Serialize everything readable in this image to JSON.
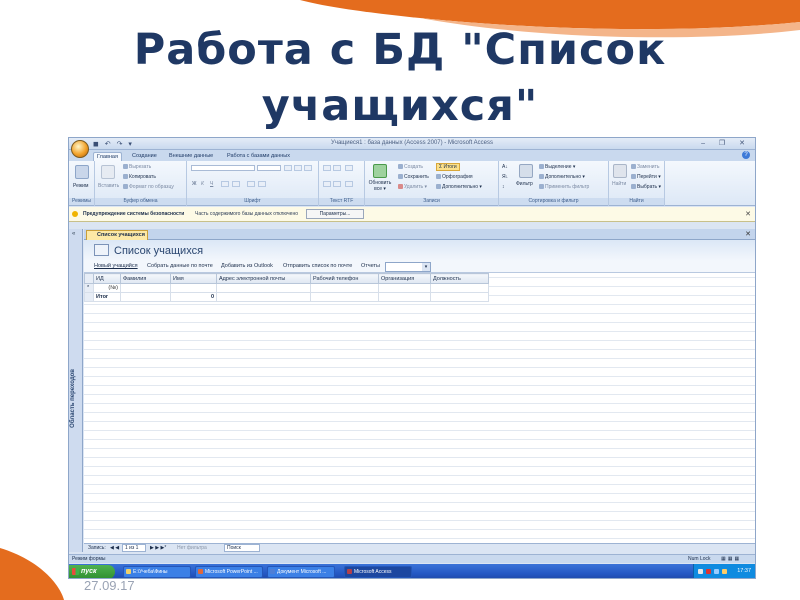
{
  "slide": {
    "title": "Работа с БД \"Список учащихся\"",
    "date": "27.09.17"
  },
  "window": {
    "title": "Учащиеся1 : база данных (Access 2007) - Microsoft Access",
    "qat": "◼ ↶ ↷ ▾",
    "controls": "– ❐ ✕",
    "help": "?"
  },
  "ribbon": {
    "tabs": [
      "Главная",
      "Создание",
      "Внешние данные",
      "Работа с базами данных"
    ],
    "groups": {
      "views": {
        "label": "Режимы",
        "button": "Режим"
      },
      "clipboard": {
        "label": "Буфер обмена",
        "paste": "Вставить",
        "cut": "Вырезать",
        "copy": "Копировать",
        "format_painter": "Формат по образцу"
      },
      "font": {
        "label": "Шрифт",
        "bold": "Ж",
        "italic": "К",
        "underline": "Ч"
      },
      "richtext": {
        "label": "Текст RTF"
      },
      "records": {
        "label": "Записи",
        "refresh": "Обновить все ▾",
        "new": "Создать",
        "save": "Сохранить",
        "delete": "Удалить ▾",
        "totals": "Итоги",
        "spelling": "Орфография",
        "more": "Дополнительно ▾"
      },
      "sort_filter": {
        "label": "Сортировка и фильтр",
        "filter": "Фильтр",
        "selection": "Выделение ▾",
        "advanced": "Дополнительно ▾",
        "toggle_filter": "Применить фильтр"
      },
      "find": {
        "label": "Найти",
        "find": "Найти",
        "replace": "Заменить",
        "goto": "Перейти ▾",
        "select": "Выбрать ▾"
      }
    }
  },
  "message_bar": {
    "warning": "Предупреждение системы безопасности",
    "text": "Часть содержимого базы данных отключено",
    "button": "Параметры..."
  },
  "nav_pane": {
    "chevron": "«",
    "label": "Область переходов"
  },
  "document": {
    "tab": "Список учащихся",
    "close": "✕",
    "header_title": "Список учащихся",
    "actions": [
      "Новый учащийся",
      "Собрать данные по почте",
      "Добавить из Outlook",
      "Отправить список по почте",
      "Отчеты"
    ],
    "columns": [
      "ИД",
      "Фамилия",
      "Имя",
      "Адрес электронной почты",
      "Рабочий телефон",
      "Организация",
      "Должность"
    ],
    "new_row_marker": "(№)",
    "total_label": "Итог",
    "total_value": "0"
  },
  "record_nav": {
    "label": "Запись:",
    "first_prev": "◀ ◀",
    "position": "1 из 1",
    "next_last": "▶ ▶ ▶*",
    "filter": "Нет фильтра",
    "search": "Поиск"
  },
  "status_bar": {
    "mode": "Режим формы",
    "numlock": "Num Lock"
  },
  "taskbar": {
    "start": "пуск",
    "items": [
      "E:\\Учеба\\Фины",
      "Microsoft PowerPoint ...",
      "Документ Microsoft ...",
      "Microsoft Access"
    ],
    "clock": "17:37"
  },
  "colors": {
    "title": "#1f3864",
    "accent_orange": "#e46c1e",
    "ribbon_blue": "#dbe5f3"
  }
}
